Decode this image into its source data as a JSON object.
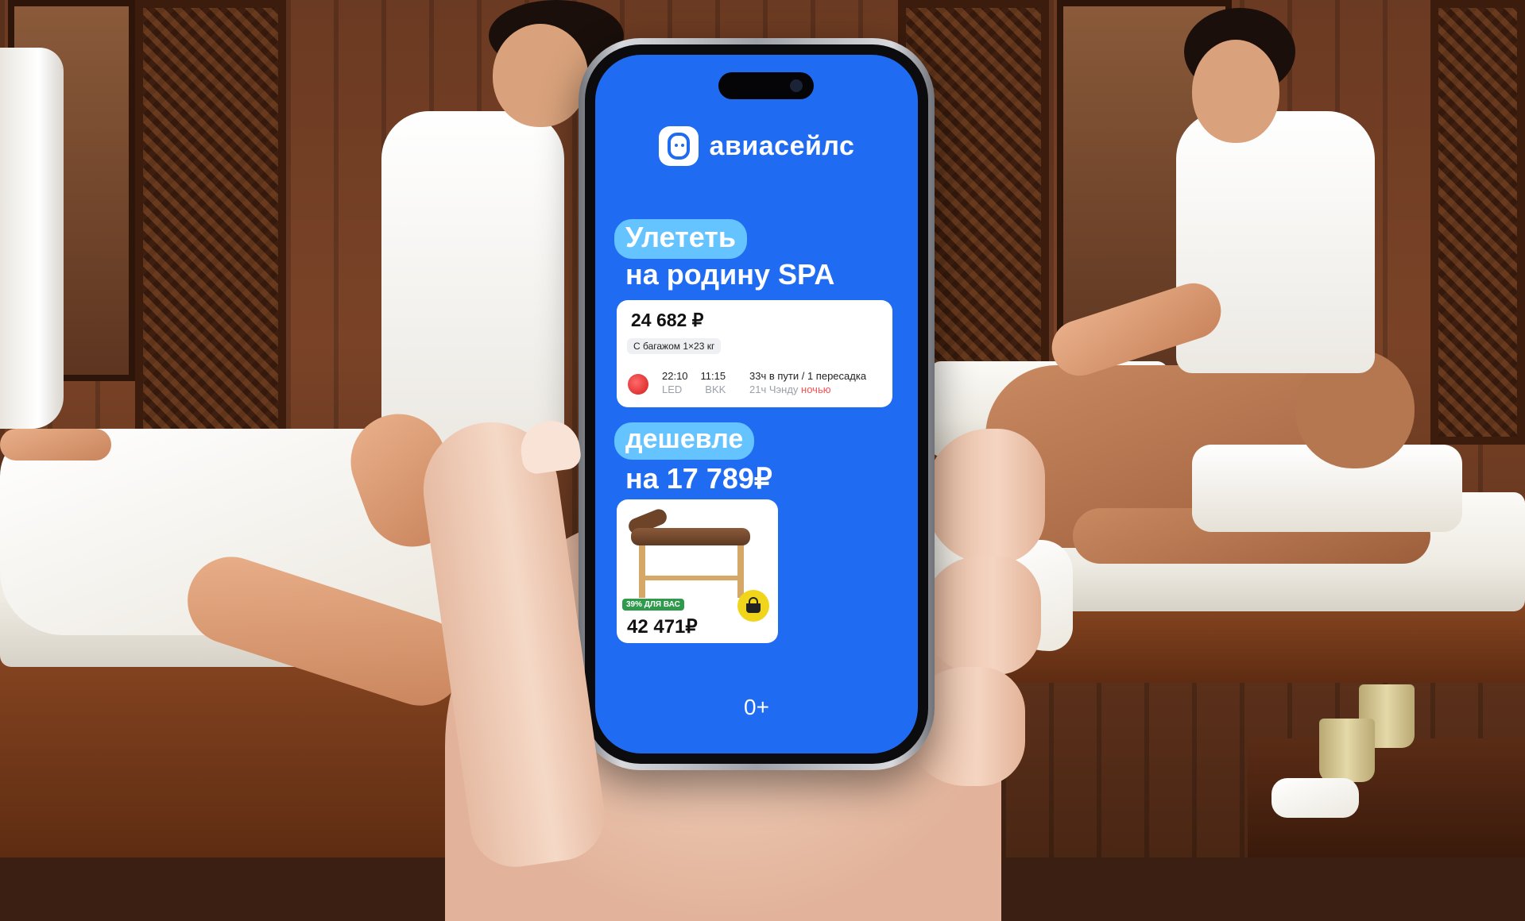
{
  "brand": {
    "name": "авиасейлс",
    "icon": "aviasales-logo-icon"
  },
  "headline": {
    "pill": "Улететь",
    "line": "на родину SPA"
  },
  "ticket": {
    "price": "24 682 ₽",
    "baggage": "С багажом 1×23 кг",
    "airline_icon": "sichuan-airlines-icon",
    "depart_time": "22:10",
    "arrive_time": "11:15",
    "depart_code": "LED",
    "arrive_code": "BKK",
    "duration": "33ч в пути / 1 пересадка",
    "layover": "21ч Чэнду",
    "layover_note": "ночью"
  },
  "saving": {
    "pill": "дешевле",
    "line": "на 17 789₽"
  },
  "product": {
    "discount": "39% ДЛЯ ВАС",
    "price": "42 471₽",
    "cart_icon": "basket-icon"
  },
  "age_rating": "0+",
  "colors": {
    "screen": "#1f6bf2",
    "pill": "#65c3ff",
    "discount": "#2f9a4c",
    "cart": "#f1d51b",
    "night": "#ff4f4f"
  }
}
